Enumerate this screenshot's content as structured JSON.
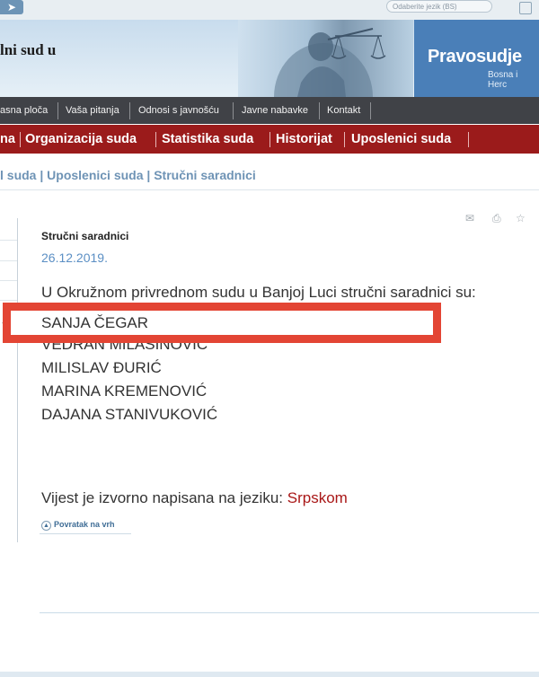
{
  "topbar": {
    "back_icon": "arrow-right-icon",
    "language_label": "Odaberite jezik (BS)"
  },
  "header": {
    "court_name": "lni sud u",
    "logo_text": "Pravosudje",
    "logo_sub": "Bosna i Herc"
  },
  "nav_top": [
    "asna ploča",
    "Vaša pitanja",
    "Odnosi s javnošću",
    "Javne nabavke",
    "Kontakt"
  ],
  "nav_main": [
    "na",
    "Organizacija suda",
    "Statistika suda",
    "Historijat",
    "Uposlenici suda"
  ],
  "breadcrumb": "l suda | Uposlenici suda | Stručni saradnici",
  "article": {
    "title": "Stručni saradnici",
    "date": "26.12.2019.",
    "intro": "U Okružnom privrednom sudu u Banjoj Luci stručni saradnici su:",
    "names": [
      "SANJA ČEGAR",
      "VEDRAN MILAŠINOVIĆ",
      "MILISLAV ĐURIĆ",
      "MARINA KREMENOVIĆ",
      "DAJANA STANIVUKOVIĆ"
    ],
    "source_prefix": "Vijest je izvorno napisana na jeziku:",
    "source_language": "Srpskom",
    "back_to_top": "Povratak na vrh"
  },
  "article_icons": [
    "envelope-icon",
    "print-icon",
    "star-icon"
  ],
  "colors": {
    "accent_red": "#9b1b1b",
    "nav_dark": "#404247",
    "link_blue": "#6e93b5",
    "highlight": "#e34534"
  }
}
